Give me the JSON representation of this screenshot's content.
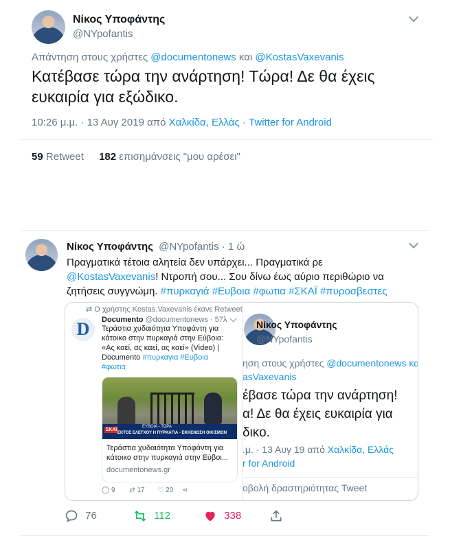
{
  "tweet1": {
    "author_name": "Νίκος Υποφάντης",
    "author_handle": "@NYpofantis",
    "reply_prefix": "Απάντηση στους χρήστες",
    "reply_user1": "@documentonews",
    "reply_and": "και",
    "reply_user2": "@KostasVaxevanis",
    "text_line1": "Κατέβασε τώρα την ανάρτηση! Τώρα! Δε θα έχεις",
    "text_line2": "ευκαιρία για εξώδικο.",
    "timestamp": "10:26 μ.μ. · 13 Αυγ 2019 από",
    "location": "Χαλκίδα, Ελλάς",
    "separator": "·",
    "client": "Twitter for Android",
    "retweet_count": "59",
    "retweet_label": "Retweet",
    "like_count": "182",
    "like_label": "επισημάνσεις \"μου αρέσει\""
  },
  "tweet2": {
    "author_name": "Νίκος Υποφάντης",
    "author_handle": "@NYpofantis",
    "time_ago": "· 1 ώ",
    "text_line1": "Πραγματικά τέτοια αλητεία δεν υπάρχει... Πραγματικά ρε",
    "text_line2_mention": "@KostasVaxevanis",
    "text_line2_rest": "! Ντροπή σου... Σου δίνω έως αύριο περιθώριο να",
    "text_line3_start": "ζητήσεις συγγνώμη.",
    "hashtags": "#πυρκαγιά #Ευβοια #φωτια #ΣΚΑΪ #πυροσβεστες",
    "reply_count": "76",
    "retweet_count": "112",
    "like_count": "338",
    "screenshot": {
      "retweet_note": "Ο χρήστης Kostas.Vaxevanis έκανε Retweet",
      "doc_logo": "D",
      "doc_name": "Documento",
      "doc_handle": "@documentonews · 57λ",
      "doc_text_line1": "Τεράστια χυδαιότητα Υποφάντη για",
      "doc_text_line2": "κάτοικο στην πυρκαγιά στην Εύβοια:",
      "doc_text_line3": "«Ας καεί, ας καεί, ας καεί» (Video) |",
      "doc_text_line4_start": "Documento",
      "doc_text_line4_tags": "#πυρκαγια #Ευβοια",
      "doc_text_line5": "#φωτια",
      "video_banner_top": "ΕΥΒΟΙΑ - ΤΩΡΑ",
      "video_banner_text": "ΕΚΤΟΣ ΕΛΕΓΧΟΥ Η ΠΥΡΚΑΓΙΑ - ΕΚΚΕΝΩΣΗ ΟΙΚΙΣΜΩΝ",
      "video_channel": "ΣΚΑΪ",
      "link_title_line1": "Τεράστια χυδαιότητα Υποφάντη για",
      "link_title_line2": "κάτοικο στην πυρκαγιά στην Εύβοι...",
      "link_domain": "documentonews.gr",
      "doc_reply_count": "9",
      "doc_retweet_count": "17",
      "doc_like_count": "20",
      "bg_name": "Νίκος Υποφάντης",
      "bg_handle": "@NYpofantis",
      "bg_reply_line1": "ηση στους χρήστες",
      "bg_reply_user1": "@documentonews κα",
      "bg_reply_line2": "asVaxevanis",
      "bg_text_line1": "έβασε τώρα την ανάρτηση!",
      "bg_text_line2": "α! Δε θα έχεις ευκαιρία για",
      "bg_text_line3": "δικο.",
      "bg_time": ".μ. · 13 Αυγ 19 από",
      "bg_location": "Χαλκίδα, Ελλάς",
      "bg_client": "r for Android",
      "bg_activity": "οβολή δραστηριότητας Tweet"
    }
  }
}
